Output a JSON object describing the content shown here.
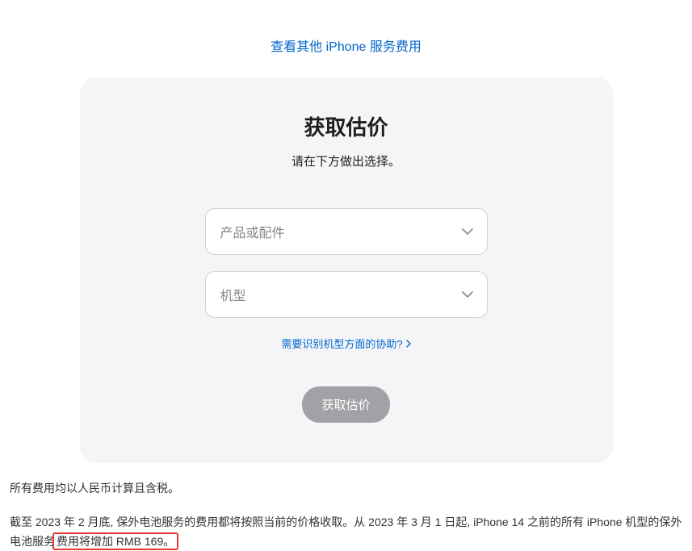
{
  "header": {
    "top_link": "查看其他 iPhone 服务费用"
  },
  "card": {
    "title": "获取估价",
    "subtitle": "请在下方做出选择。",
    "select_product_placeholder": "产品或配件",
    "select_model_placeholder": "机型",
    "help_link": "需要识别机型方面的协助?",
    "submit_label": "获取估价"
  },
  "footer": {
    "line1": "所有费用均以人民币计算且含税。",
    "line2_part1": "截至 2023 年 2 月底, 保外电池服务的费用都将按照当前的价格收取。从 2023 年 3 月 1 日起, iPhone 14 之前的所有 iPhone 机型的保外电池服务",
    "line2_highlight": "费用将增加 RMB 169。"
  }
}
